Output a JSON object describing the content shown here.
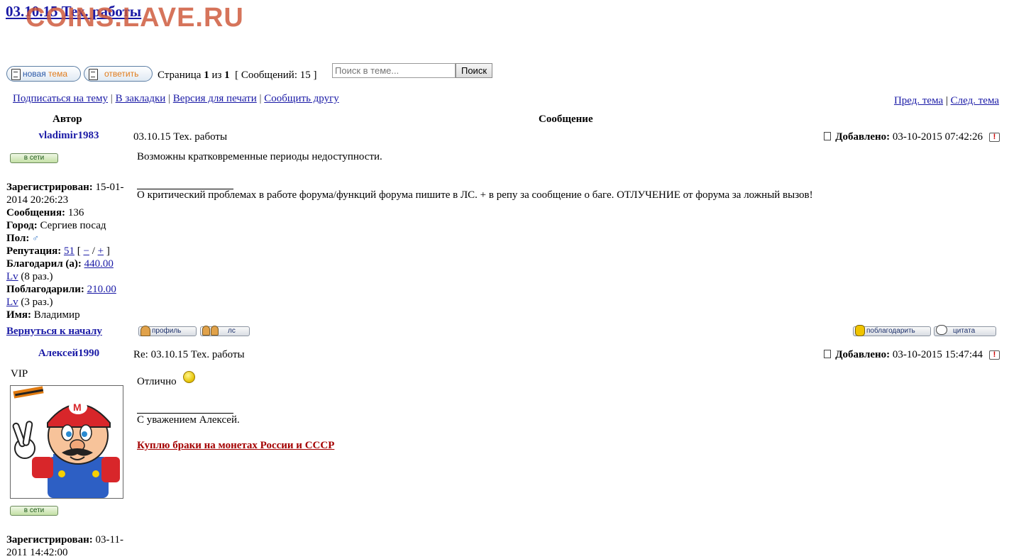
{
  "topic": {
    "title": "03.10.15 Тех. работы"
  },
  "watermark": "COINS.LAVE.RU",
  "toolbar": {
    "new_topic_part1": "новая",
    "new_topic_part2": "тема",
    "reply_label": "ответить",
    "page_prefix": "Страница",
    "page_current": "1",
    "page_of": "из",
    "page_total": "1",
    "messages_label": "[ Сообщений: 15 ]",
    "search_placeholder": "Поиск в теме...",
    "search_button": "Поиск"
  },
  "topic_links": {
    "subscribe": "Подписаться на тему",
    "bookmark": "В закладки",
    "print": "Версия для печати",
    "tell_friend": "Сообщить другу",
    "sep": "|"
  },
  "topic_nav": {
    "prev": "Пред. тема",
    "next": "След. тема",
    "sep": "|"
  },
  "columns": {
    "author": "Автор",
    "message": "Сообщение"
  },
  "posts": [
    {
      "author": "vladimir1983",
      "online_label": "в сети",
      "registered_label": "Зарегистрирован:",
      "registered_value": "15-01-2014 20:26:23",
      "messages_label": "Сообщения:",
      "messages_value": "136",
      "city_label": "Город:",
      "city_value": "Сергиев посад",
      "gender_label": "Пол:",
      "gender_icon": "male-icon",
      "reputation_label": "Репутация:",
      "reputation_value": "51",
      "rep_open": "[",
      "rep_minus": "−",
      "rep_slash": "/",
      "rep_plus": "+",
      "rep_close": "]",
      "thanked_label": "Благодарил (а):",
      "thanked_value_a": "440.00",
      "thanked_value_b": "Lv",
      "thanked_times": "(8 раз.)",
      "got_thanks_label": "Поблагодарили:",
      "got_thanks_value_a": "210.00",
      "got_thanks_value_b": "Lv",
      "got_thanks_times": "(3 раз.)",
      "name_label": "Имя:",
      "name_value": "Владимир",
      "back_to_top": "Вернуться к началу",
      "subject": "03.10.15 Тех. работы",
      "added_label": "Добавлено:",
      "added_value": "03-10-2015 07:42:26",
      "text": "Возможны кратковременные периоды недоступности.",
      "signature": "О критический проблемах в работе форума/функций форума пишите в ЛС. + в репу за сообщение о баге. ОТЛУЧЕНИЕ от форума за ложный вызов!",
      "btn_profile": "профиль",
      "btn_pm": "лс",
      "btn_thank": "поблагодарить",
      "btn_quote": "цитата"
    },
    {
      "author": "Алексей1990",
      "rank": "VIP",
      "online_label": "в сети",
      "registered_label": "Зарегистрирован:",
      "registered_value": "03-11-2011 14:42:00",
      "subject": "Re: 03.10.15 Тех. работы",
      "added_label": "Добавлено:",
      "added_value": "03-10-2015 15:47:44",
      "text": "Отлично",
      "signature": "С уважением Алексей.",
      "sig_link": "Куплю браки на монетах России и СССР"
    }
  ],
  "colors": {
    "link": "#1a1aa6",
    "watermark": "#cd5537",
    "sig_link": "#a40000"
  }
}
